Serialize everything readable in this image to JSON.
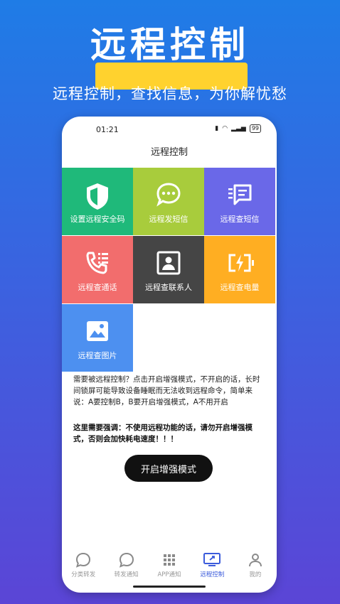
{
  "hero": {
    "title": "远程控制",
    "subtitle": "远程控制，查找信息，为你解忧愁"
  },
  "status": {
    "time": "01:21",
    "battery": "99"
  },
  "appbar": {
    "title": "远程控制"
  },
  "tiles": [
    {
      "label": "设置远程安全码",
      "color": "#1fb97a",
      "icon": "shield-icon"
    },
    {
      "label": "远程发短信",
      "color": "#a8cc3c",
      "icon": "chat-icon"
    },
    {
      "label": "远程查短信",
      "color": "#6a68e8",
      "icon": "message-list-icon"
    },
    {
      "label": "远程查通话",
      "color": "#f26d6d",
      "icon": "phone-list-icon"
    },
    {
      "label": "远程查联系人",
      "color": "#454545",
      "icon": "contact-icon"
    },
    {
      "label": "远程查电量",
      "color": "#ffae22",
      "icon": "battery-icon"
    },
    {
      "label": "远程查图片",
      "color": "#4d90f0",
      "icon": "image-icon"
    }
  ],
  "notice": {
    "text": "需要被远程控制？点击开启增强模式，不开启的话，长时间锁屏可能导致设备睡眠而无法收到远程命令，简单来说：A要控制B，B要开启增强模式，A不用开启",
    "bold": "这里需要强调：不使用远程功能的话，请勿开启增强模式，否则会加快耗电速度！！！"
  },
  "button": {
    "label": "开启增强模式"
  },
  "tabs": [
    {
      "label": "分类转发",
      "icon": "chat-bubble-icon",
      "active": false
    },
    {
      "label": "转发通知",
      "icon": "chat-bubble-icon",
      "active": false
    },
    {
      "label": "APP通知",
      "icon": "app-grid-icon",
      "active": false
    },
    {
      "label": "远程控制",
      "icon": "remote-screen-icon",
      "active": true
    },
    {
      "label": "我的",
      "icon": "user-icon",
      "active": false
    }
  ]
}
